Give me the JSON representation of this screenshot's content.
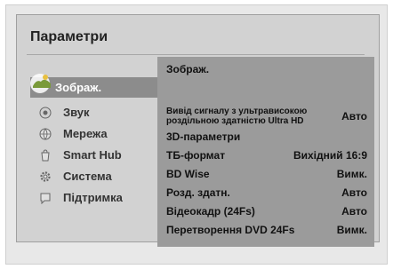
{
  "panel": {
    "title": "Параметри"
  },
  "sidebar": {
    "items": [
      {
        "label": "Зображ.",
        "icon": "picture-icon",
        "selected": true
      },
      {
        "label": "Звук",
        "icon": "sound-icon"
      },
      {
        "label": "Мережа",
        "icon": "network-icon"
      },
      {
        "label": "Smart Hub",
        "icon": "smart-hub-icon"
      },
      {
        "label": "Система",
        "icon": "gear-icon"
      },
      {
        "label": "Підтримка",
        "icon": "support-icon"
      }
    ]
  },
  "content": {
    "title": "Зображ.",
    "rows": [
      {
        "label_line1": "Вивід сигналу з ультрависокою",
        "label_line2": "роздільною здатністю Ultra HD",
        "value": "Авто"
      },
      {
        "label": "3D-параметри",
        "value": ""
      },
      {
        "label": "ТБ-формат",
        "value": "Вихідний 16:9"
      },
      {
        "label": "BD Wise",
        "value": "Вимк."
      },
      {
        "label": "Розд. здатн.",
        "value": "Авто"
      },
      {
        "label": "Відеокадр (24Fs)",
        "value": "Авто"
      },
      {
        "label": "Перетворення DVD 24Fs",
        "value": "Вимк."
      }
    ]
  }
}
